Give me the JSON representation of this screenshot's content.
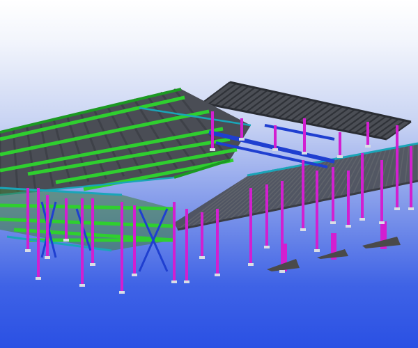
{
  "scene": {
    "description_visible": false,
    "colors": {
      "deck": "#4c4f57",
      "deck_dark": "#3a3d44",
      "joist": "#5f636b",
      "green_beam": "#2fcf2f",
      "green_dark": "#1c9a22",
      "magenta_column": "#d21fd0",
      "blue_beam": "#1f3fd0",
      "teal_beam": "#1aa5b8",
      "footing": "#4a4a4a",
      "base_plate": "#d9dde6"
    }
  }
}
